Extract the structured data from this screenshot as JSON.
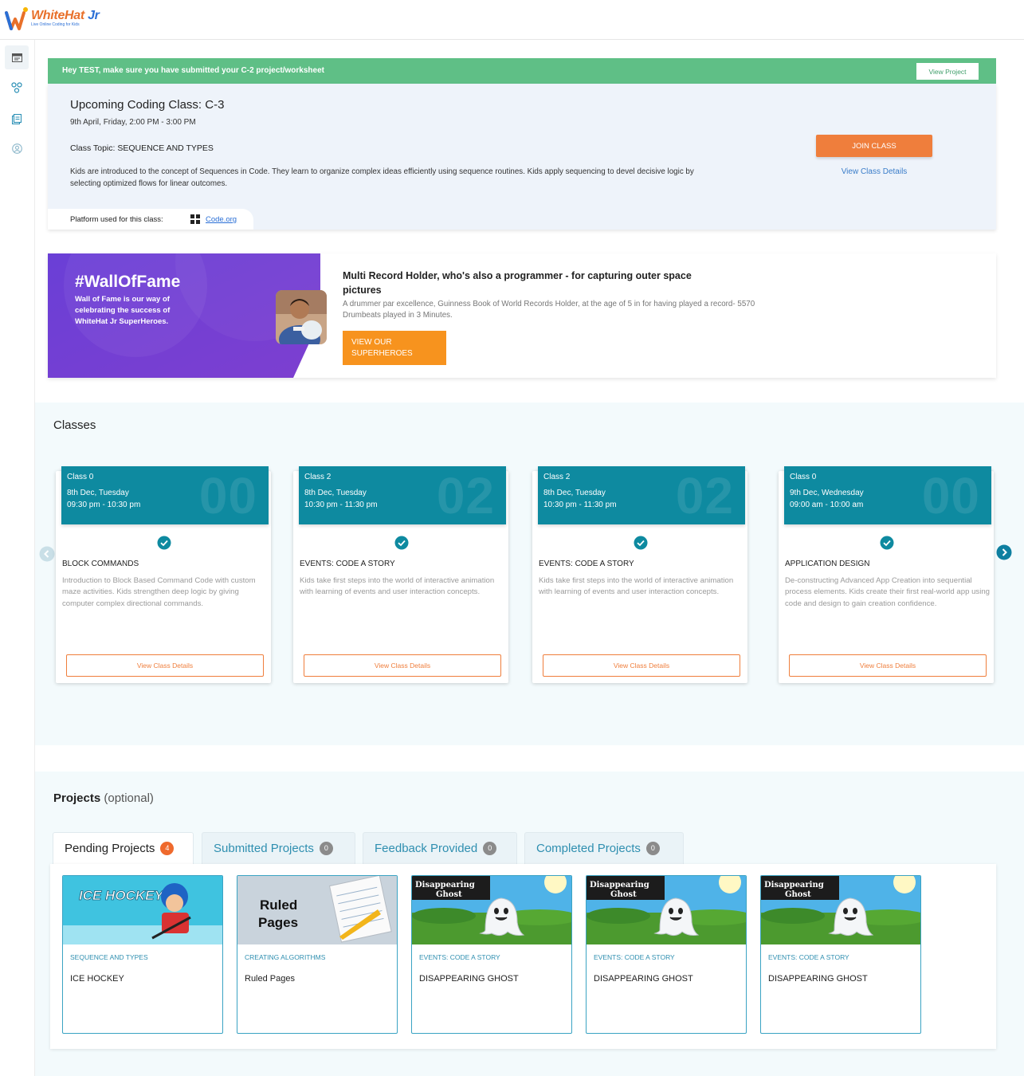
{
  "brand": {
    "logo_name": "WhiteHat",
    "logo_name_jr": " Jr",
    "logo_tagline": "Live Online Coding for Kids"
  },
  "sidebar": {
    "items": [
      {
        "icon": "dashboard-icon"
      },
      {
        "icon": "projects-icon"
      },
      {
        "icon": "notes-icon"
      },
      {
        "icon": "profile-icon"
      }
    ]
  },
  "banner": {
    "message": "Hey TEST, make sure you have submitted your C-2 project/worksheet",
    "button": "View Project"
  },
  "upcoming": {
    "title": "Upcoming Coding Class: C-3",
    "datetime": "9th April, Friday, 2:00 PM - 3:00 PM",
    "topic": "Class Topic: SEQUENCE AND TYPES",
    "description": "Kids are introduced to the concept of Sequences in Code. They learn to organize  complex ideas efficiently using sequence routines. Kids apply sequencing to devel decisive logic by selecting optimized flows for linear outcomes.",
    "join_button": "JOIN CLASS",
    "details_link": "View Class Details",
    "platform_label": "Platform used for this class:",
    "platform_name": "Code.org"
  },
  "wall_of_fame": {
    "title": "#WallOfFame",
    "subtitle": "Wall of Fame is our way of celebrating the success of WhiteHat Jr SuperHeroes.",
    "headline": "Multi Record Holder, who's also a programmer - for capturing outer space pictures",
    "description": "A drummer par excellence, Guinness Book of World Records Holder, at the age of 5 in for having played a record- 5570 Drumbeats played in 3 Minutes.",
    "button": "VIEW OUR SUPERHEROES",
    "colors": {
      "purple_start": "#6a3fd6",
      "purple_end": "#7d3fd0"
    }
  },
  "classes": {
    "title": "Classes",
    "cards": [
      {
        "class": "Class 0",
        "date": "8th Dec, Tuesday",
        "time": "09:30 pm - 10:30 pm",
        "number": "00",
        "title": "BLOCK COMMANDS",
        "description": "Introduction to Block Based Command Code with custom maze activities. Kids strengthen deep logic by giving computer complex directional commands.",
        "button": "View Class Details"
      },
      {
        "class": "Class 2",
        "date": "8th Dec, Tuesday",
        "time": "10:30 pm - 11:30 pm",
        "number": "02",
        "title": "EVENTS: CODE A STORY",
        "description": "Kids take first steps into the world of interactive animation with learning of events and user interaction concepts.",
        "button": "View Class Details"
      },
      {
        "class": "Class 2",
        "date": "8th Dec, Tuesday",
        "time": "10:30 pm - 11:30 pm",
        "number": "02",
        "title": "EVENTS: CODE A STORY",
        "description": "Kids take first steps into the world of interactive animation with learning of events and user interaction concepts.",
        "button": "View Class Details"
      },
      {
        "class": "Class 0",
        "date": "9th Dec, Wednesday",
        "time": "09:00 am - 10:00 am",
        "number": "00",
        "title": "APPLICATION DESIGN",
        "description": "De-constructing Advanced App Creation into sequential process elements. Kids create their first real-world app using code and design to gain creation confidence.",
        "button": "View Class Details"
      }
    ]
  },
  "projects": {
    "title": "Projects",
    "optional": "(optional)",
    "tabs": [
      {
        "label": "Pending Projects",
        "count": "4",
        "active": true
      },
      {
        "label": "Submitted Projects",
        "count": "0",
        "active": false
      },
      {
        "label": "Feedback Provided",
        "count": "0",
        "active": false
      },
      {
        "label": "Completed Projects",
        "count": "0",
        "active": false
      }
    ],
    "cards": [
      {
        "category": "SEQUENCE AND TYPES",
        "name": "ICE HOCKEY",
        "image_text": "ICE HOCKEY"
      },
      {
        "category": "CREATING ALGORITHMS",
        "name": "Ruled Pages",
        "image_text": "Ruled Pages"
      },
      {
        "category": "EVENTS: CODE A STORY",
        "name": "DISAPPEARING GHOST",
        "image_text": "Disappearing Ghost"
      },
      {
        "category": "EVENTS: CODE A STORY",
        "name": "DISAPPEARING GHOST",
        "image_text": "Disappearing Ghost"
      },
      {
        "category": "EVENTS: CODE A STORY",
        "name": "DISAPPEARING GHOST",
        "image_text": "Disappearing Ghost"
      }
    ]
  }
}
